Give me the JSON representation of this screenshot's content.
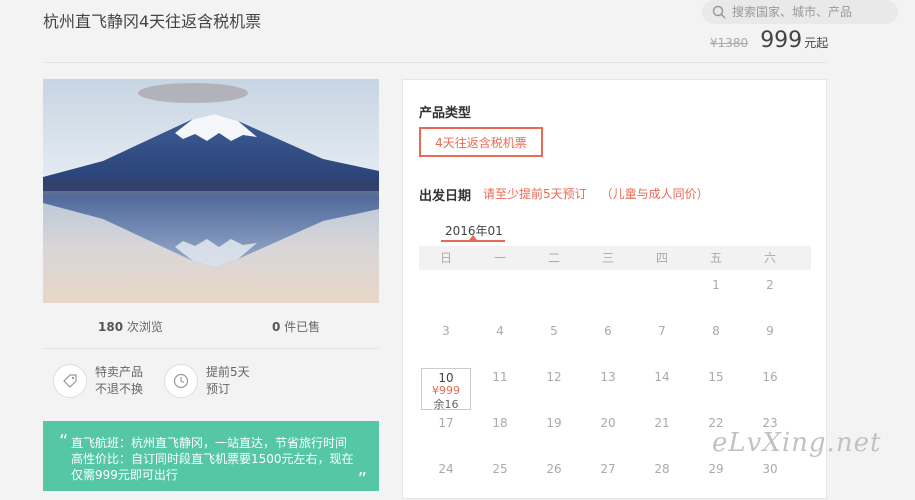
{
  "header": {
    "title": "杭州直飞静冈4天往返含税机票",
    "search_placeholder": "搜索国家、城市、产品",
    "old_price": "¥1380",
    "price": "999",
    "price_unit": "元起"
  },
  "stats": {
    "views_count": "180",
    "views_label": " 次浏览",
    "sold_count": "0",
    "sold_label": " 件已售"
  },
  "features": [
    {
      "icon": "tag-icon",
      "line1": "特卖产品",
      "line2": "不退不换"
    },
    {
      "icon": "clock-icon",
      "line1": "提前5天",
      "line2": "预订"
    }
  ],
  "notice": {
    "open_quote": "“",
    "line1": "直飞航班：杭州直飞静冈，一站直达，节省旅行时间",
    "line2": "高性价比：自订同时段直飞机票要1500元左右，现在",
    "line3": "仅需999元即可出行",
    "close_quote": "”"
  },
  "booking": {
    "product_type_label": "产品类型",
    "product_type_option": "4天往返含税机票",
    "date_label": "出发日期",
    "hint_advance": "请至少提前5天预订",
    "hint_child": "（儿童与成人同价）",
    "month": "2016年01",
    "weekdays": [
      "日",
      "一",
      "二",
      "三",
      "四",
      "五",
      "六"
    ],
    "weeks": [
      [
        "",
        "",
        "",
        "",
        "",
        "1",
        "2"
      ],
      [
        "3",
        "4",
        "5",
        "6",
        "7",
        "8",
        "9"
      ],
      [
        "10",
        "11",
        "12",
        "13",
        "14",
        "15",
        "16"
      ],
      [
        "17",
        "18",
        "19",
        "20",
        "21",
        "22",
        "23"
      ],
      [
        "24",
        "25",
        "26",
        "27",
        "28",
        "29",
        "30"
      ]
    ],
    "selected": {
      "day": "10",
      "price": "¥999",
      "remaining": "余16"
    }
  },
  "watermark": "eLvXing.net",
  "colors": {
    "accent": "#e86a55",
    "notice_bg": "#55c7a5"
  }
}
